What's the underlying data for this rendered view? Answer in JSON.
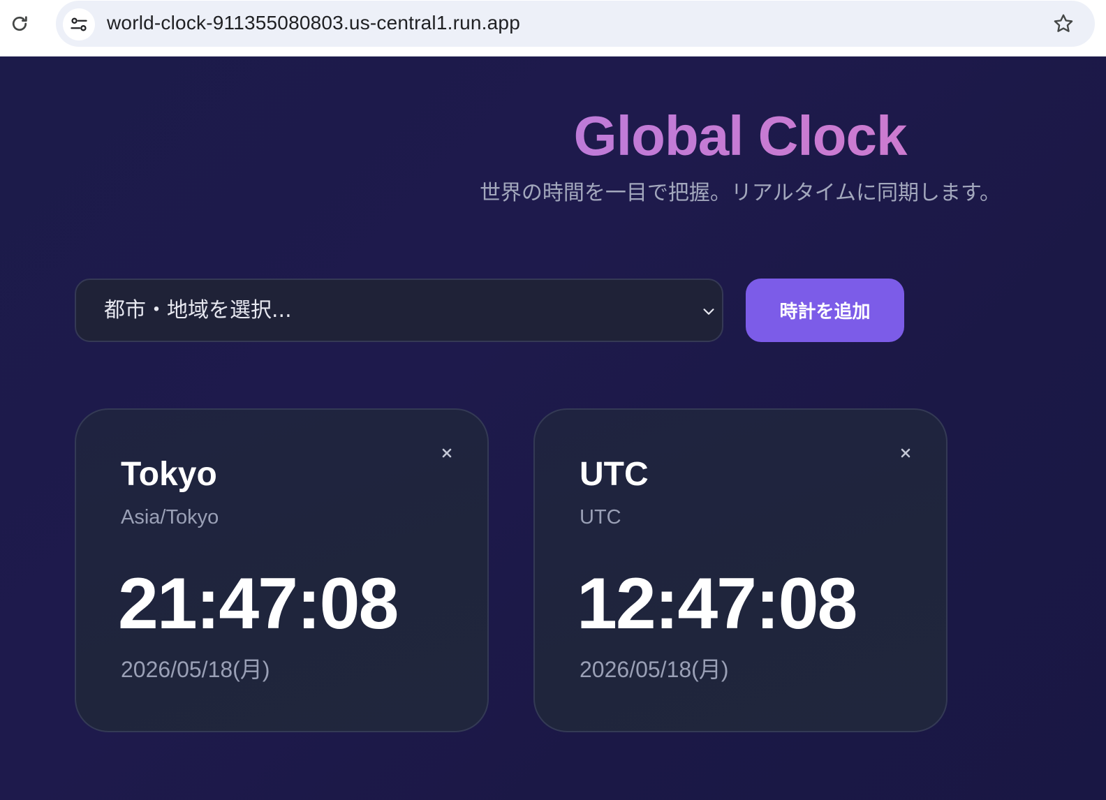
{
  "browser": {
    "url": "world-clock-911355080803.us-central1.run.app",
    "icons": {
      "reload": "reload-icon",
      "site_info": "site-settings-icon",
      "bookmark": "star-icon"
    }
  },
  "header": {
    "title": "Global Clock",
    "subtitle": "世界の時間を一目で把握。リアルタイムに同期します。"
  },
  "controls": {
    "select_placeholder": "都市・地域を選択...",
    "add_button_label": "時計を追加"
  },
  "clocks": [
    {
      "city": "Tokyo",
      "timezone": "Asia/Tokyo",
      "time": "21:47:08",
      "date": "2026/05/18(月)"
    },
    {
      "city": "UTC",
      "timezone": "UTC",
      "time": "12:47:08",
      "date": "2026/05/18(月)"
    }
  ],
  "colors": {
    "background": "#1b1a45",
    "accent": "#7c5ce8",
    "title_gradient_start": "#a47ae6",
    "title_gradient_end": "#dd7cc0",
    "card_background": "#1f243e",
    "muted_text": "#9aa0b6"
  }
}
